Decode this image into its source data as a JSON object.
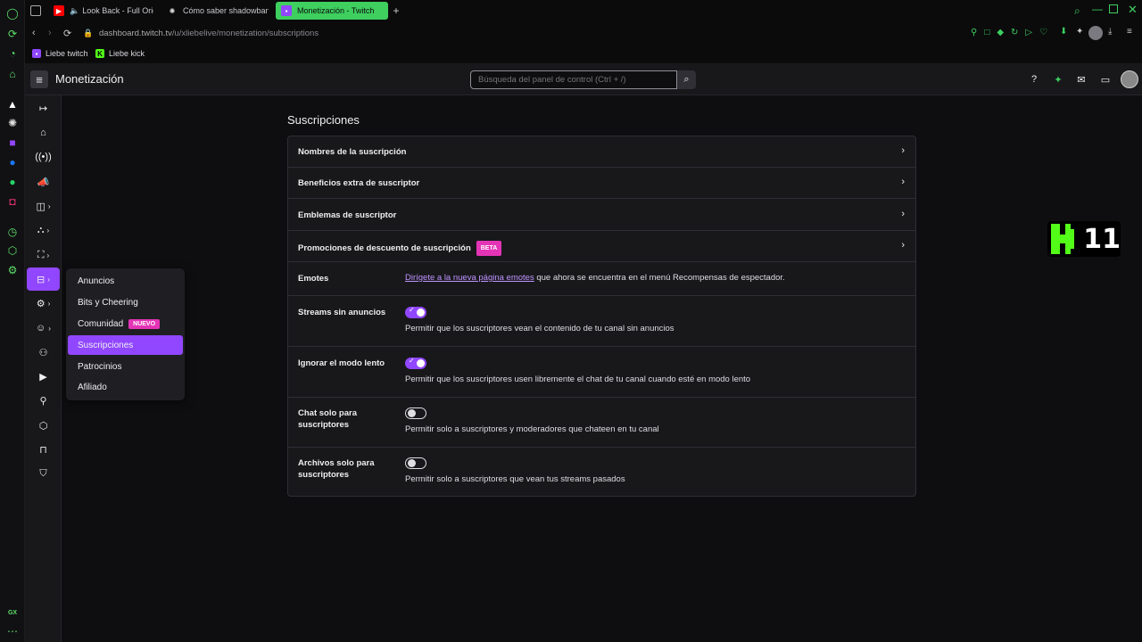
{
  "browser": {
    "tabs": [
      {
        "label": "Look Back - Full Origi",
        "icon": "youtube-icon"
      },
      {
        "label": "Cómo saber shadowban",
        "icon": "chatgpt-icon"
      },
      {
        "label": "Monetización - Twitch",
        "icon": "twitch-icon"
      }
    ],
    "url_host": "dashboard.twitch.tv",
    "url_path": "/u/xliebelive/monetization/subscriptions",
    "bookmarks": [
      {
        "label": "Liebe twitch"
      },
      {
        "label": "Liebe kick"
      }
    ],
    "os_label": "GX",
    "accent_color": "#3ecf5f"
  },
  "header": {
    "title": "Monetización",
    "search_placeholder": "Búsqueda del panel de control (Ctrl + /)"
  },
  "flyout": {
    "items": [
      {
        "label": "Anuncios"
      },
      {
        "label": "Bits y Cheering"
      },
      {
        "label": "Comunidad",
        "badge": "NUEVO"
      },
      {
        "label": "Suscripciones"
      },
      {
        "label": "Patrocinios"
      },
      {
        "label": "Afiliado"
      }
    ]
  },
  "content": {
    "title": "Suscripciones",
    "nav_rows": [
      {
        "label": "Nombres de la suscripción"
      },
      {
        "label": "Beneficios extra de suscriptor"
      },
      {
        "label": "Emblemas de suscriptor"
      },
      {
        "label": "Promociones de descuento de suscripción",
        "badge": "BETA"
      }
    ],
    "emotes": {
      "label": "Emotes",
      "link": "Dirígete a la nueva página emotes",
      "text": " que ahora se encuentra en el menú Recompensas de espectador."
    },
    "toggles": [
      {
        "label": "Streams sin anuncios",
        "on": true,
        "desc": "Permitir que los suscriptores vean el contenido de tu canal sin anuncios"
      },
      {
        "label": "Ignorar el modo lento",
        "on": true,
        "desc": "Permitir que los suscriptores usen libremente el chat de tu canal cuando esté en modo lento"
      },
      {
        "label": "Chat solo para suscriptores",
        "on": false,
        "desc": "Permitir solo a suscriptores y moderadores que chateen en tu canal"
      },
      {
        "label": "Archivos solo para suscriptores",
        "on": false,
        "desc": "Permitir solo a suscriptores que vean tus streams pasados"
      }
    ]
  },
  "overlay": {
    "number": "11"
  },
  "colors": {
    "twitch_purple": "#9147ff",
    "badge_pink": "#e434b6",
    "kick_green": "#53fc18"
  }
}
